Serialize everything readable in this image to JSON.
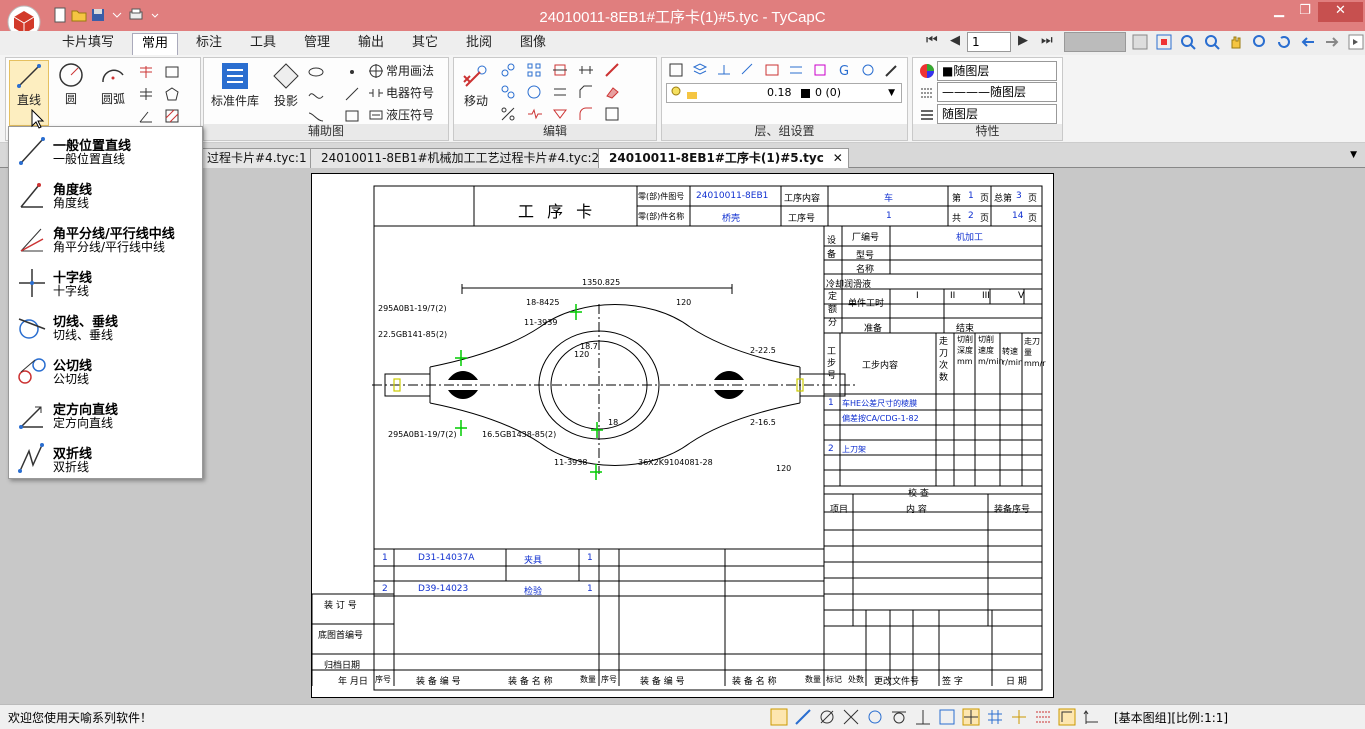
{
  "window": {
    "title": "24010011-8EB1#工序卡(1)#5.tyc - TyCapC",
    "minimize": "▁",
    "restore": "❐",
    "close": "✕"
  },
  "menu": {
    "tabs": [
      "卡片填写",
      "常用",
      "标注",
      "工具",
      "管理",
      "输出",
      "其它",
      "批阅",
      "图像"
    ]
  },
  "ribbon": {
    "draw": {
      "line": "直线",
      "circle": "圆",
      "arc": "圆弧",
      "std_lib": "标准件库",
      "projection": "投影",
      "common_draw": "常用画法",
      "electric": "电器符号",
      "hydraulic": "液压符号",
      "group_label": "辅助图"
    },
    "edit": {
      "move": "移动",
      "group_label": "编辑"
    },
    "layer": {
      "line_width": "0.18",
      "color_index": "0 (0)",
      "group_label": "层、组设置"
    },
    "props": {
      "color": "■随图层",
      "linetype": "————随图层",
      "linewidth": "随图层",
      "group_label": "特性"
    },
    "nav": {
      "page": "1"
    }
  },
  "doc_tabs": [
    "过程卡片#4.tyc:1",
    "24010011-8EB1#机械加工工艺过程卡片#4.tyc:2",
    "24010011-8EB1#工序卡(1)#5.tyc"
  ],
  "dropdown": {
    "items": [
      {
        "title": "一般位置直线",
        "sub": "一般位置直线"
      },
      {
        "title": "角度线",
        "sub": "角度线"
      },
      {
        "title": "角平分线/平行线中线",
        "sub": "角平分线/平行线中线"
      },
      {
        "title": "十字线",
        "sub": "十字线"
      },
      {
        "title": "切线、垂线",
        "sub": "切线、垂线"
      },
      {
        "title": "公切线",
        "sub": "公切线"
      },
      {
        "title": "定方向直线",
        "sub": "定方向直线"
      },
      {
        "title": "双折线",
        "sub": "双折线"
      }
    ]
  },
  "sheet": {
    "title": "工 序 卡",
    "part_no_label": "零(部)件图号",
    "part_no": "24010011-8EB1",
    "part_name_label": "零(部)件名称",
    "part_name": "桥壳",
    "op_content_label": "工序内容",
    "op_content": "车",
    "op_no_label": "工序号",
    "op_no": "1",
    "page_label": "第",
    "page": "1",
    "page_unit": "页",
    "total_label": "总第",
    "total": "3",
    "sheets_label": "共",
    "sheets": "2",
    "total_sheets": "14",
    "equip_label": "设备",
    "factory_no_label": "厂编号",
    "factory_no": "机加工",
    "model_label": "型号",
    "name_label": "名称",
    "coolant_label": "冷却润滑液",
    "quota_label": "定额分",
    "unit_time_label": "单件工时",
    "prep_label": "准备",
    "end_label": "结束",
    "roman": [
      "I",
      "II",
      "III",
      "V"
    ],
    "step_no_label": "工步号",
    "step_content_label": "工步内容",
    "cols": [
      "走刀次数",
      "切削深度mm",
      "切削速度m/min",
      "转速r/min",
      "走刀量mm/r"
    ],
    "step1_no": "1",
    "step1_a": "车HE公差尺寸的棱膜",
    "step1_b": "偏差按CA/CDG-1-82",
    "step2_no": "2",
    "step2": "上刀架",
    "check_label": "校 查",
    "item_label": "项目",
    "content_label": "内 容",
    "equip_no_label": "装备序号",
    "tool1_no": "1",
    "tool1_code": "D31-14037A",
    "tool1_name": "夹具",
    "tool1_qty": "1",
    "tool2_no": "2",
    "tool2_code": "D39-14023",
    "tool2_name": "检验",
    "tool2_qty": "1",
    "bind_label": "装 订 号",
    "base_label": "底图首编号",
    "archive_label": "归档日期",
    "footer": [
      "年 月日",
      "序号",
      "装 备 编 号",
      "装 备 名 称",
      "数量",
      "序号",
      "装 备 编 号",
      "装 备 名 称",
      "数量",
      "标记",
      "处数",
      "更改文件号",
      "签 字",
      "日 期"
    ],
    "dims": {
      "d1": "1350.825",
      "d2": "295A0B1-19/7(2)",
      "d3": "22.5GB141-85(2)",
      "d4": "18-8425",
      "d5": "11-3939",
      "d6": "18.7",
      "d7": "120",
      "d8": "2-22.5",
      "d9": "2-16.5",
      "d10": "295A0B1-19/7(2)",
      "d11": "16.5GB1438-85(2)",
      "d12": "11-3938",
      "d13": "36X2K9104081-28",
      "d14": "18",
      "d15": "120",
      "d16": "120"
    }
  },
  "status": {
    "welcome": "欢迎您使用天喻系列软件！",
    "info": "[基本图组][比例:1:1]"
  }
}
